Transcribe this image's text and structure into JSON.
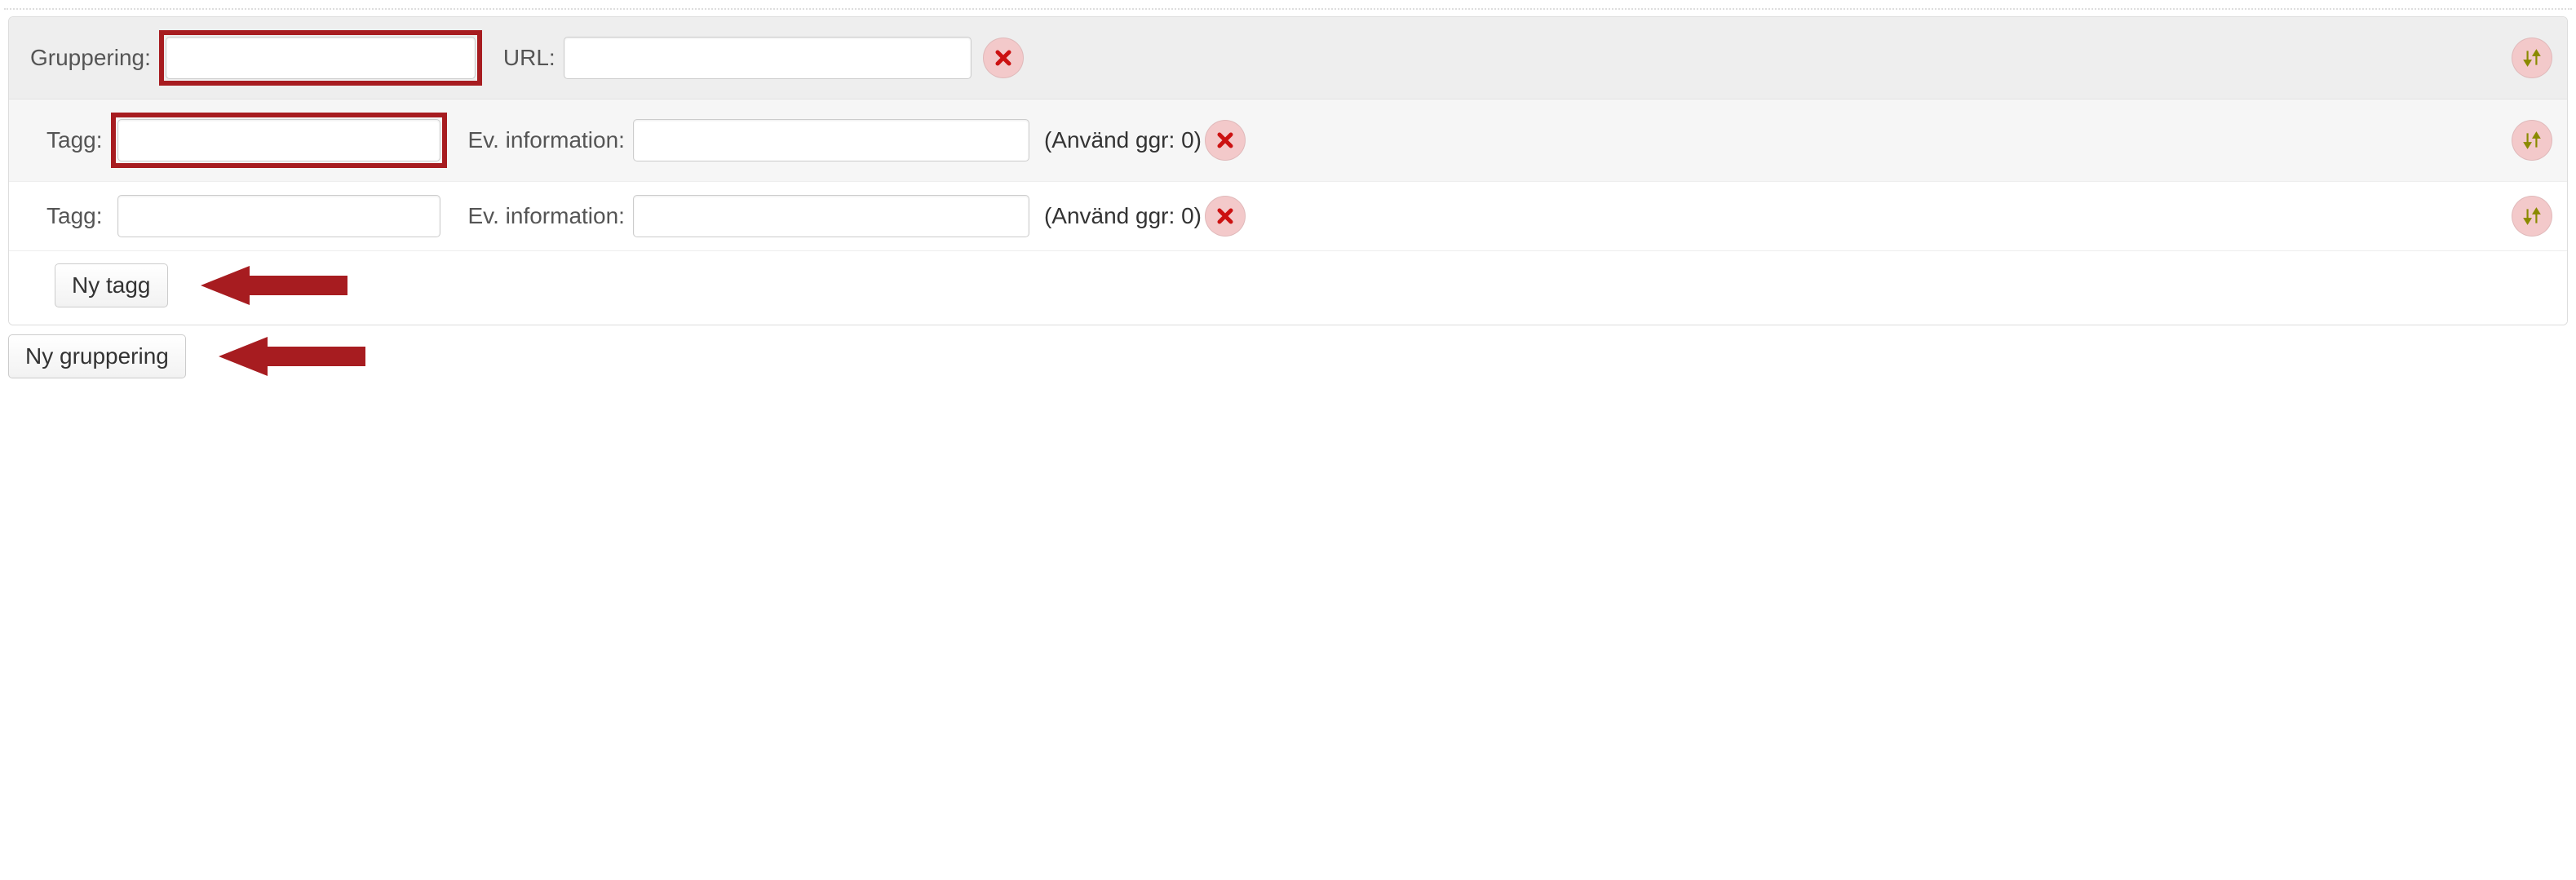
{
  "labels": {
    "gruppering": "Gruppering:",
    "url": "URL:",
    "tagg": "Tagg:",
    "info": "Ev. information:",
    "usage_prefix": "(Använd ggr: ",
    "usage_suffix": ")"
  },
  "group": {
    "grouping_value": "",
    "url_value": ""
  },
  "tags": [
    {
      "name": "",
      "info": "",
      "usage": 0
    },
    {
      "name": "",
      "info": "",
      "usage": 0
    }
  ],
  "buttons": {
    "new_tag": "Ny tagg",
    "new_group": "Ny gruppering"
  }
}
